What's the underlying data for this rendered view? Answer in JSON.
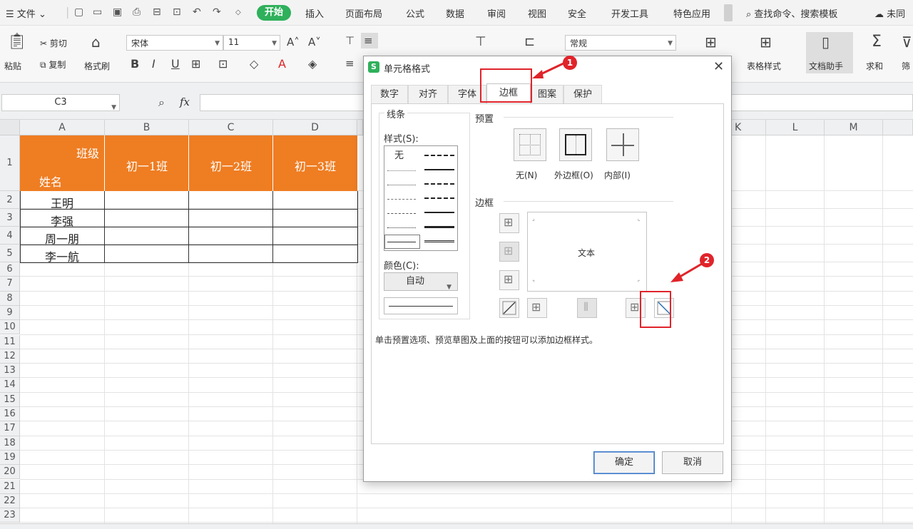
{
  "menubar": {
    "file_label": "文件",
    "start_label": "开始",
    "tabs": [
      "插入",
      "页面布局",
      "公式",
      "数据",
      "审阅",
      "视图",
      "安全",
      "开发工具",
      "特色应用"
    ],
    "search_label": "查找命令、搜索模板",
    "right_partial": "未同"
  },
  "ribbon": {
    "paste_label": "粘贴",
    "cut_label": "剪切",
    "copy_label": "复制",
    "format_painter_label": "格式刷",
    "font_name": "宋体",
    "font_size": "11",
    "number_format": "常规",
    "table_style_label": "表格样式",
    "doc_helper_label": "文档助手",
    "sum_label": "求和",
    "filter_partial": "筛"
  },
  "formula_bar": {
    "cell_ref": "C3",
    "fx": "fx"
  },
  "sheet": {
    "columns": [
      "A",
      "B",
      "C",
      "D",
      "K",
      "L",
      "M"
    ],
    "rows": [
      "1",
      "2",
      "3",
      "4",
      "5",
      "6",
      "7",
      "8",
      "9",
      "10",
      "11",
      "12",
      "13",
      "14",
      "15",
      "16",
      "17",
      "18",
      "19",
      "20",
      "21",
      "22",
      "23"
    ],
    "header": {
      "a1_top": "班级",
      "a1_bottom": "姓名",
      "b1": "初一1班",
      "c1": "初一2班",
      "d1": "初一3班"
    },
    "names": [
      "王明",
      "李强",
      "周一朋",
      "李一航"
    ],
    "header_color": "#ef7d22"
  },
  "dialog": {
    "title": "单元格格式",
    "close_icon": "close-icon",
    "tabs": [
      "数字",
      "对齐",
      "字体",
      "边框",
      "图案",
      "保护"
    ],
    "active_tab": "边框",
    "line_group_label": "线条",
    "style_label": "样式(S):",
    "none_style_label": "无",
    "color_label": "颜色(C):",
    "color_value": "自动",
    "presets_label": "预置",
    "preset_none": "无(N)",
    "preset_outline": "外边框(O)",
    "preset_inside": "内部(I)",
    "border_label": "边框",
    "preview_text": "文本",
    "hint": "单击预置选项、预览草图及上面的按钮可以添加边框样式。",
    "ok_label": "确定",
    "cancel_label": "取消"
  },
  "annotations": {
    "badge1": "1",
    "badge2": "2",
    "color": "#e0242a"
  }
}
